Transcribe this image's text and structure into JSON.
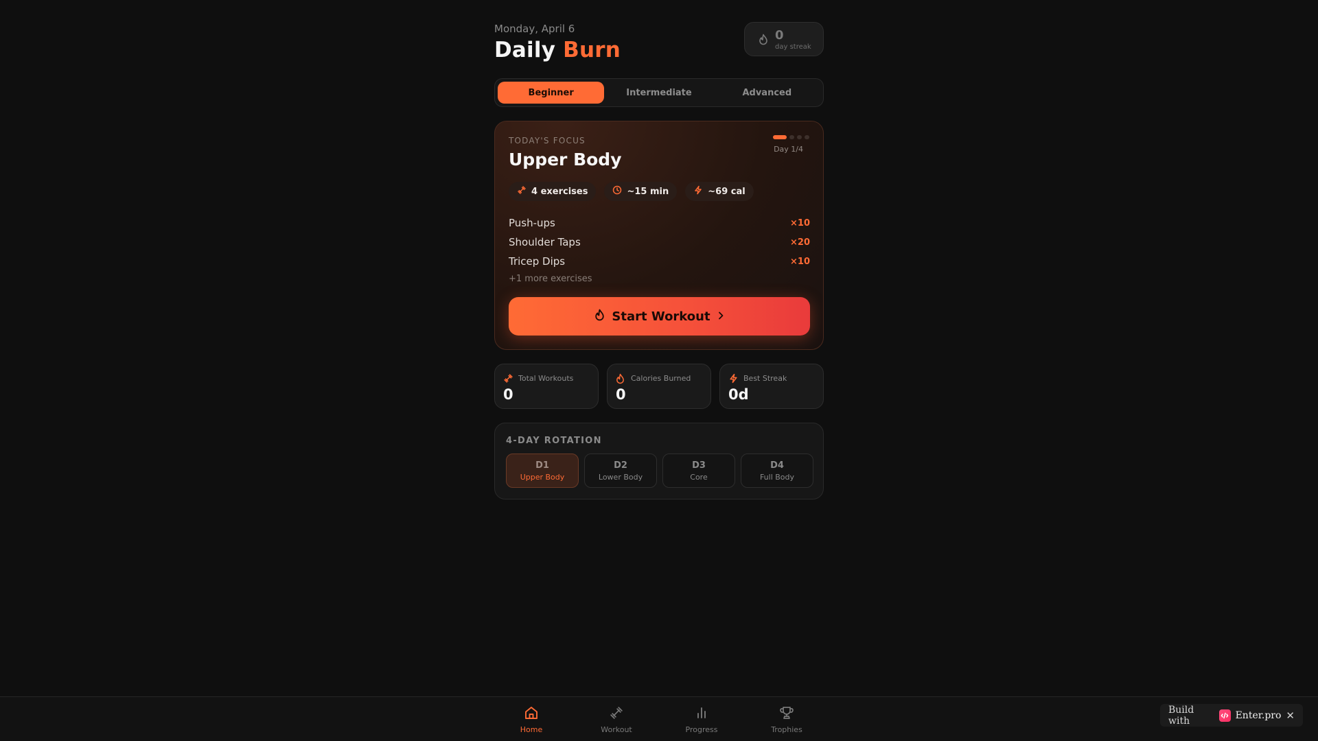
{
  "header": {
    "date": "Monday, April 6",
    "title_main": "Daily",
    "title_accent": "Burn",
    "streak_value": "0",
    "streak_label": "day streak"
  },
  "levels": {
    "beginner": "Beginner",
    "intermediate": "Intermediate",
    "advanced": "Advanced",
    "selected": "Beginner"
  },
  "focus": {
    "eyebrow": "TODAY'S FOCUS",
    "title": "Upper Body",
    "day_label": "Day 1/4",
    "day_progress": 0.25,
    "chips": {
      "exercises": "4 exercises",
      "duration": "~15 min",
      "calories": "~69 cal"
    },
    "exercises": [
      {
        "name": "Push-ups",
        "reps": "×10"
      },
      {
        "name": "Shoulder Taps",
        "reps": "×20"
      },
      {
        "name": "Tricep Dips",
        "reps": "×10"
      }
    ],
    "more": "+1 more exercises",
    "start_label": "Start Workout"
  },
  "stats": [
    {
      "label": "Total Workouts",
      "value": "0",
      "icon": "dumbbell-icon"
    },
    {
      "label": "Calories Burned",
      "value": "0",
      "icon": "flame-icon"
    },
    {
      "label": "Best Streak",
      "value": "0d",
      "icon": "bolt-icon"
    }
  ],
  "rotation": {
    "title": "4-DAY ROTATION",
    "days": [
      {
        "code": "D1",
        "name": "Upper Body",
        "active": true
      },
      {
        "code": "D2",
        "name": "Lower Body",
        "active": false
      },
      {
        "code": "D3",
        "name": "Core",
        "active": false
      },
      {
        "code": "D4",
        "name": "Full Body",
        "active": false
      }
    ]
  },
  "nav": {
    "home": "Home",
    "workout": "Workout",
    "progress": "Progress",
    "trophies": "Trophies",
    "active": "Home"
  },
  "builder": {
    "prefix": "Build with",
    "brand": "Enter.pro",
    "close": "✕"
  },
  "colors": {
    "accent": "#ff6b35",
    "background": "#0f0f0f"
  }
}
